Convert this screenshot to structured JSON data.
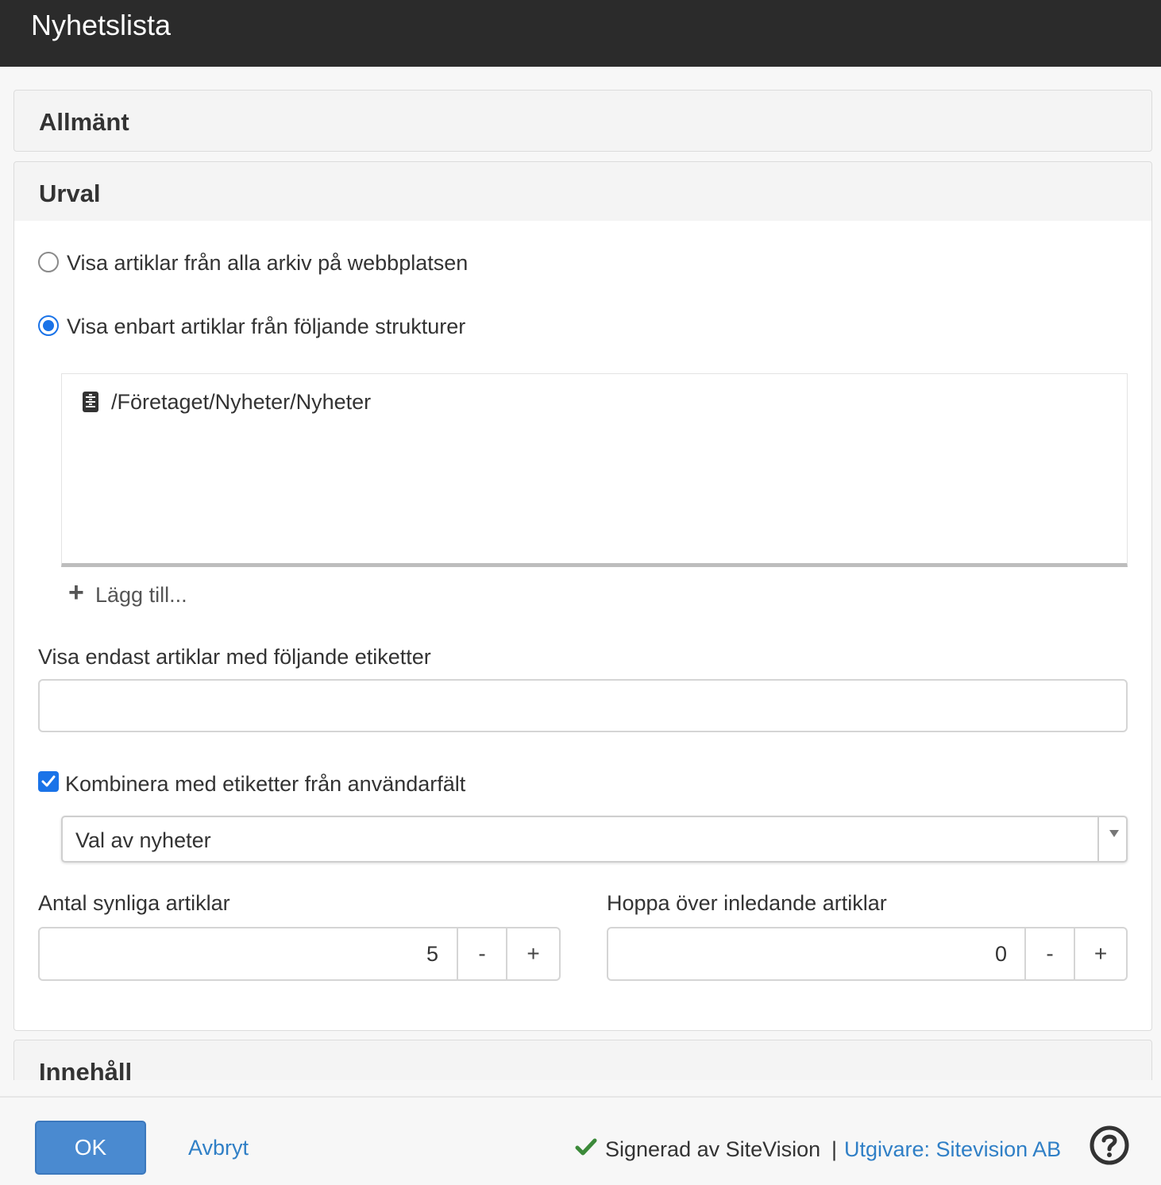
{
  "window": {
    "title": "Nyhetslista"
  },
  "sections": {
    "general": {
      "title": "Allmänt"
    },
    "selection": {
      "title": "Urval",
      "radio_all": {
        "label": "Visa artiklar från alla arkiv på webbplatsen",
        "checked": false
      },
      "radio_only": {
        "label": "Visa enbart artiklar från följande strukturer",
        "checked": true
      },
      "structures": [
        "/Företaget/Nyheter/Nyheter"
      ],
      "add_label": "Lägg till...",
      "tags_label": "Visa endast artiklar med följande etiketter",
      "tags_value": "",
      "combine": {
        "label": "Kombinera med etiketter från användarfält",
        "checked": true
      },
      "user_field_select": {
        "value": "Val av nyheter"
      },
      "visible_count": {
        "label": "Antal synliga artiklar",
        "value": "5",
        "minus": "-",
        "plus": "+"
      },
      "skip_count": {
        "label": "Hoppa över inledande artiklar",
        "value": "0",
        "minus": "-",
        "plus": "+"
      }
    },
    "content": {
      "title": "Innehåll"
    }
  },
  "footer": {
    "ok_label": "OK",
    "cancel_label": "Avbryt",
    "signed_text": "Signerad av SiteVision",
    "separator": "|",
    "publisher_label": "Utgivare: Sitevision AB"
  },
  "colors": {
    "accent": "#1a73e8",
    "ok_button": "#4a8ad0",
    "link": "#2f7fc6",
    "titlebar": "#2b2b2b",
    "check": "#3c8a3a"
  },
  "icons": [
    "archive-icon",
    "plus-icon",
    "checkmark-icon",
    "help-icon",
    "chevron-down-icon"
  ]
}
